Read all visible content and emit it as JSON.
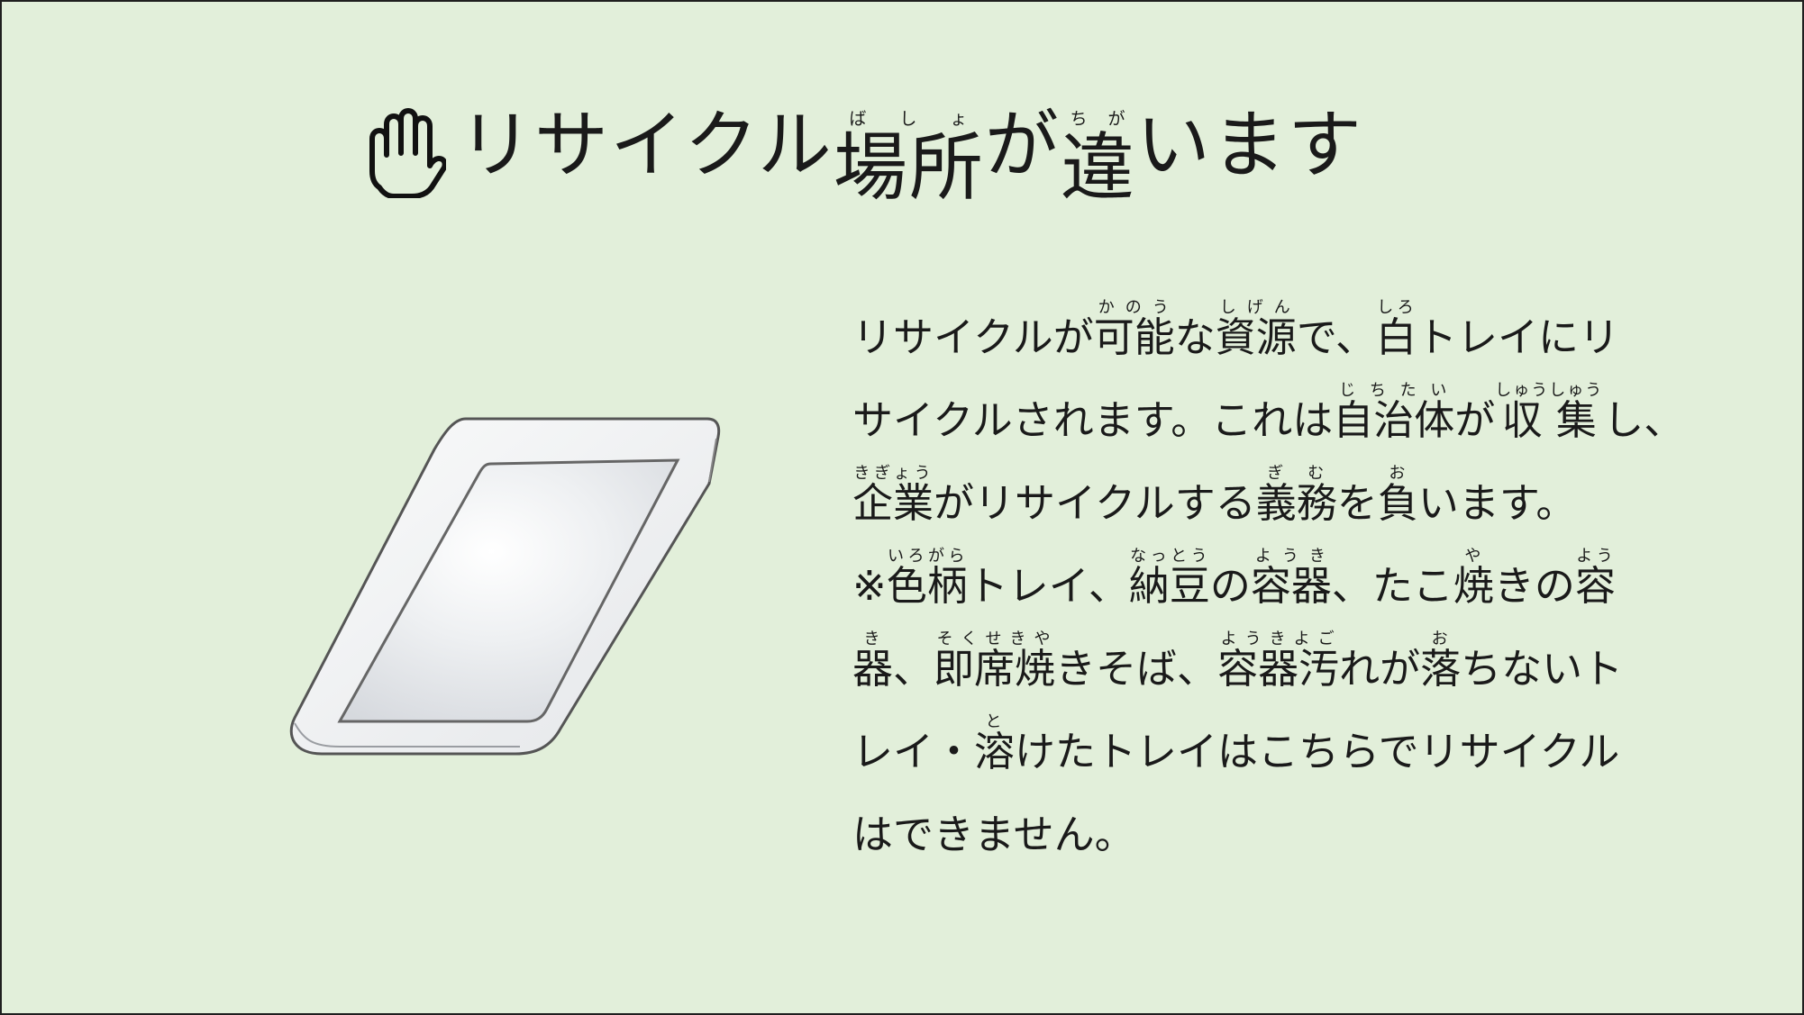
{
  "title": {
    "icon": "hand-icon",
    "segments": [
      {
        "text": "リサイクル"
      },
      {
        "text": "場所",
        "ruby": "ばしょ"
      },
      {
        "text": "が"
      },
      {
        "text": "違",
        "ruby": "ちが"
      },
      {
        "text": "います"
      }
    ]
  },
  "illustration": {
    "icon": "white-tray-icon"
  },
  "body": {
    "lines": [
      [
        {
          "text": "リサイクルが"
        },
        {
          "text": "可能",
          "ruby": "かのう"
        },
        {
          "text": "な"
        },
        {
          "text": "資源",
          "ruby": "しげん"
        },
        {
          "text": "で、"
        },
        {
          "text": "白",
          "ruby": "しろ"
        },
        {
          "text": "トレイにリ"
        }
      ],
      [
        {
          "text": "サイクルされます。これは"
        },
        {
          "text": "自治体",
          "ruby": "じちたい"
        },
        {
          "text": "が"
        },
        {
          "text": "収集",
          "ruby": "しゅうしゅう"
        },
        {
          "text": "し、"
        }
      ],
      [
        {
          "text": "企業",
          "ruby": "きぎょう"
        },
        {
          "text": "がリサイクルする"
        },
        {
          "text": "義務",
          "ruby": "ぎむ"
        },
        {
          "text": "を"
        },
        {
          "text": "負",
          "ruby": "お"
        },
        {
          "text": "います。"
        }
      ],
      [
        {
          "text": "※"
        },
        {
          "text": "色柄",
          "ruby": "いろがら"
        },
        {
          "text": "トレイ、"
        },
        {
          "text": "納豆",
          "ruby": "なっとう"
        },
        {
          "text": "の"
        },
        {
          "text": "容器",
          "ruby": "ようき"
        },
        {
          "text": "、たこ"
        },
        {
          "text": "焼",
          "ruby": "や"
        },
        {
          "text": "きの"
        },
        {
          "text": "容",
          "ruby": "よう"
        }
      ],
      [
        {
          "text": "器",
          "ruby": "き"
        },
        {
          "text": "、"
        },
        {
          "text": "即席焼",
          "ruby": "そくせきや"
        },
        {
          "text": "きそば、"
        },
        {
          "text": "容器汚",
          "ruby": "ようきよご"
        },
        {
          "text": "れが"
        },
        {
          "text": "落",
          "ruby": "お"
        },
        {
          "text": "ちないト"
        }
      ],
      [
        {
          "text": "レイ・"
        },
        {
          "text": "溶",
          "ruby": "と"
        },
        {
          "text": "けたトレイはこちらでリサイクル"
        }
      ],
      [
        {
          "text": "はできません。"
        }
      ]
    ]
  },
  "colors": {
    "background": "#e2efda",
    "border": "#1f1f1f",
    "text": "#1a1a1a"
  }
}
